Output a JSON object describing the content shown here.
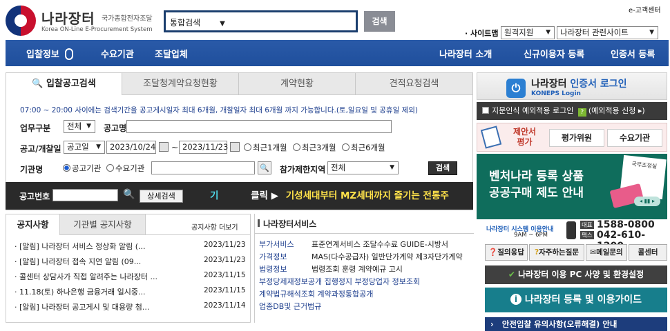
{
  "header": {
    "logo_title": "나라장터",
    "logo_subtitle": "국가종합전자조달",
    "logo_en": "Korea ON-Line E-Procurement System",
    "search_scope": "통합검색",
    "search_placeholder": "",
    "search_button": "검색",
    "cs_link": "e-고객센터",
    "sitemap_label": "· 사이트맵",
    "site_select_1": "원격지원",
    "site_select_2": "나라장터 관련사이트"
  },
  "nav": {
    "items": [
      "입찰정보",
      "수요기관",
      "조달업체",
      "나라장터 소개",
      "신규이용자 등록",
      "인증서 등록"
    ]
  },
  "search_panel": {
    "tabs": [
      "입찰공고검색",
      "조달청계약요청현황",
      "계약현황",
      "견적요청검색"
    ],
    "notice": "07:00 ~ 20:00 사이에는 검색기간을 공고게시일자 최대 6개월, 개찰일자 최대 6개월 까지 가능합니다.(토,일요일 및 공휴일 제외)",
    "business_type_label": "업무구분",
    "business_type_value": "전체",
    "notice_name_label": "공고명",
    "date_label": "공고/개찰일",
    "date_type_value": "공고일",
    "date_from": "2023/10/24",
    "date_to": "2023/11/23",
    "period_tilde": "~",
    "period_options": [
      "최근1개월",
      "최근3개월",
      "최근6개월"
    ],
    "agency_label": "기관명",
    "agency_options": [
      "공고기관",
      "수요기관"
    ],
    "region_label": "참가제한지역",
    "region_value": "전체",
    "search_button": "검색"
  },
  "bid_bar": {
    "label": "공고번호",
    "detail_button": "상세검색",
    "marquee_prefix": "기",
    "marquee_click": "클릭 ▶",
    "marquee_text": "기성세대부터 MZ세대까지 즐기는 전통주"
  },
  "notices": {
    "tabs": [
      "공지사항",
      "기관별 공지사항"
    ],
    "more_link": "공지사항 더보기",
    "rows": [
      {
        "title": "[알림] 나라장터 서비스 정상화 알림 (...",
        "date": "2023/11/23"
      },
      {
        "title": "[알림] 나라장터 접속 지연 알림 (09...",
        "date": "2023/11/23"
      },
      {
        "title": "콜센터 상담사가 직접 알려주는 나라장터 ...",
        "date": "2023/11/15"
      },
      {
        "title": "11.18(토) 하나은행 금융거래 일시중...",
        "date": "2023/11/15"
      },
      {
        "title": "[알림] 나라장터 공고게시 및 대용량 첨...",
        "date": "2023/11/14"
      }
    ]
  },
  "services": {
    "title": "나라장터서비스",
    "rows": [
      {
        "label": "부가서비스",
        "value": "표준연계서비스  조달수수료  GUIDE-시방서"
      },
      {
        "label": "가격정보",
        "value": "MAS(다수공급자)  일반단가계약  제3자단가계약"
      },
      {
        "label": "법령정보",
        "value": "법령조회  훈령  계약예규  고시"
      },
      {
        "label": "",
        "value": "부정당제재정보공개  집행정지 부정당업자 정보조회"
      },
      {
        "label": "",
        "value": "계약법규해석조회  계약과정통합공개"
      },
      {
        "label": "",
        "value": "업종DB및 근거법규"
      }
    ]
  },
  "right": {
    "login_title_1": "나라장터 ",
    "login_title_2": "인증서 로그인",
    "login_sub": "KONEPS Login",
    "fingerprint_label": "지문인식 예외적용 로그인",
    "fingerprint_link": "(예외적용 신청 ▸)",
    "proposal_label": "제안서 평가",
    "evaluator_button": "평가위원",
    "agency_button": "수요기관",
    "ad_line1": "벤처나라 등록 상품",
    "ad_line2": "공공구매 제도 안내",
    "ad_doc": "국무조정실",
    "callcenter_title": "나라장터 시스템 이용안내",
    "callcenter_hours": "9AM ~ 6PM",
    "phone_1_tag": "대표",
    "phone_1": "1588-0800",
    "phone_2_tag": "팩스",
    "phone_2": "042-610-1200",
    "help_buttons": [
      "질의응답",
      "자주하는질문",
      "메일문의",
      "콜센터"
    ],
    "env_button": "나라장터 이용 PC 사양 및 환경설정",
    "guide_button": "나라장터 등록 및 이용가이드",
    "safe_bid_button": "안전입찰 유의사항(오류해결) 안내"
  }
}
